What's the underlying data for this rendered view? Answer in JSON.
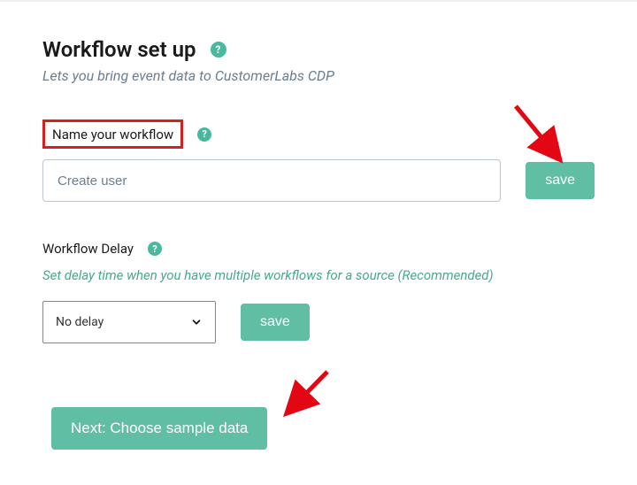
{
  "page": {
    "title": "Workflow set up",
    "subtitle": "Lets you bring event data to CustomerLabs CDP"
  },
  "nameSection": {
    "label": "Name your workflow",
    "inputValue": "Create user",
    "saveLabel": "save"
  },
  "delaySection": {
    "label": "Workflow Delay",
    "hint": "Set delay time when you have multiple workflows for a source (Recommended)",
    "selectedOption": "No delay",
    "saveLabel": "save"
  },
  "nextButton": {
    "label": "Next: Choose sample data"
  },
  "helpGlyph": "?"
}
